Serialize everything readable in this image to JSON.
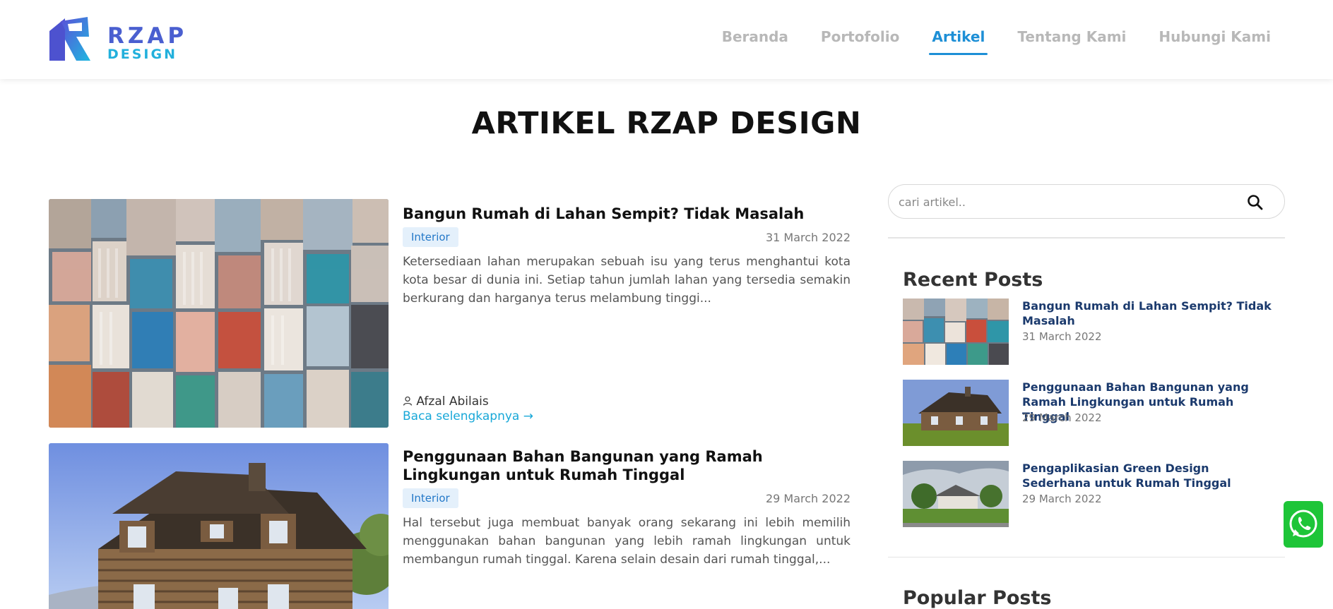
{
  "brand": {
    "line1": "RZAP",
    "line2": "DESIGN"
  },
  "nav": {
    "items": [
      {
        "label": "Beranda"
      },
      {
        "label": "Portofolio"
      },
      {
        "label": "Artikel"
      },
      {
        "label": "Tentang Kami"
      },
      {
        "label": "Hubungi Kami"
      }
    ],
    "active": "Artikel"
  },
  "page_title": "ARTIKEL RZAP DESIGN",
  "articles": [
    {
      "title": "Bangun Rumah di Lahan Sempit? Tidak Masalah",
      "tag": "Interior",
      "date": "31 March 2022",
      "excerpt": "Ketersediaan lahan merupakan sebuah isu yang terus menghantui kota kota besar di dunia ini. Setiap tahun jumlah lahan yang tersedia semakin berkurang dan harganya terus melambung tinggi...",
      "author": "Afzal Abilais",
      "read_more": "Baca selengkapnya →"
    },
    {
      "title": "Penggunaan Bahan Bangunan yang Ramah Lingkungan untuk Rumah Tinggal",
      "tag": "Interior",
      "date": "29 March 2022",
      "excerpt": "Hal tersebut juga membuat banyak orang sekarang ini lebih memilih menggunakan bahan bangunan yang lebih ramah lingkungan untuk membangun rumah tinggal. Karena selain desain dari rumah tinggal,..."
    }
  ],
  "sidebar": {
    "search_placeholder": "cari artikel..",
    "recent_heading": "Recent Posts",
    "recent_posts": [
      {
        "title": "Bangun Rumah di Lahan Sempit? Tidak Masalah",
        "date": "31 March 2022"
      },
      {
        "title": "Penggunaan Bahan Bangunan yang Ramah Lingkungan untuk Rumah Tinggal",
        "date": "29 March 2022"
      },
      {
        "title": "Pengaplikasian Green Design Sederhana untuk Rumah Tinggal",
        "date": "29 March 2022"
      }
    ],
    "popular_heading": "Popular Posts"
  },
  "colors": {
    "accent": "#1d8fd6",
    "link": "#18a8d8",
    "post_title": "#1b3a6d",
    "whatsapp": "#1ec538"
  },
  "icons": [
    "logo-house-icon",
    "search-icon",
    "user-icon",
    "arrow-right-icon",
    "whatsapp-icon"
  ]
}
